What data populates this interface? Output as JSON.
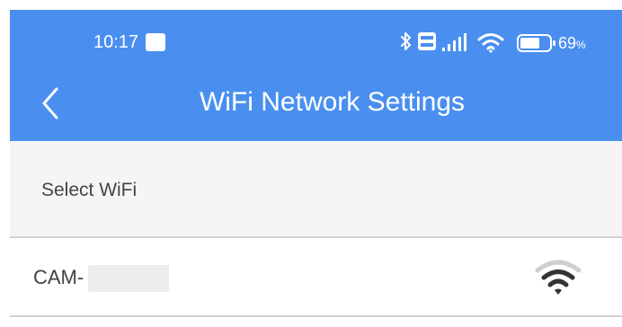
{
  "status_bar": {
    "time": "10:17",
    "battery_level": "69",
    "battery_unit": "%",
    "icons": [
      "bluetooth-icon",
      "volte-icon",
      "signal-icon",
      "wifi-icon",
      "battery-icon"
    ]
  },
  "header": {
    "title": "WiFi Network Settings",
    "back_icon": "chevron-left-icon"
  },
  "section": {
    "label": "Select WiFi"
  },
  "networks": [
    {
      "ssid_prefix": "CAM-",
      "icon": "wifi-signal-icon"
    }
  ],
  "colors": {
    "app_bar": "#4a8ff0",
    "section_bg": "#f5f5f5",
    "text": "#444444",
    "divider": "#d0d0d0"
  }
}
